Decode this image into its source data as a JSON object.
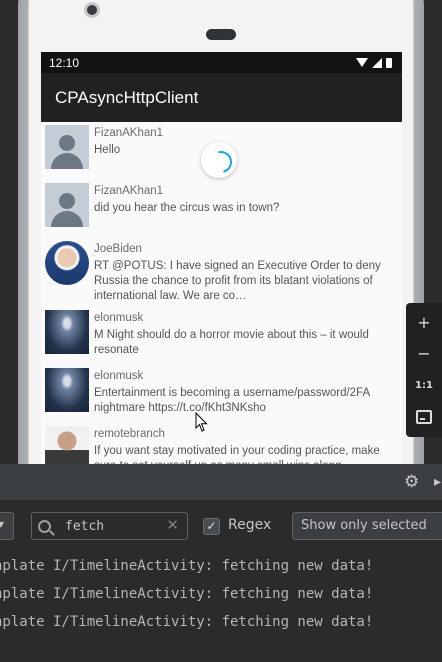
{
  "status_bar": {
    "time": "12:10",
    "icons": [
      "wifi-icon",
      "signal-icon",
      "battery-icon"
    ]
  },
  "app": {
    "title": "CPAsyncHttpClient"
  },
  "timeline": {
    "tweets": [
      {
        "handle": "FizanAKhan1",
        "text": "Hello",
        "avatar": "default-avatar"
      },
      {
        "handle": "FizanAKhan1",
        "text": "did you hear the circus was in town?",
        "avatar": "default-avatar"
      },
      {
        "handle": "JoeBiden",
        "text": "RT @POTUS: I have signed an Executive Order to deny Russia the chance to profit from its blatant violations of international law. We are co…",
        "avatar": "photo"
      },
      {
        "handle": "elonmusk",
        "text": "M Night should do a horror movie about this – it would resonate",
        "avatar": "photo"
      },
      {
        "handle": "elonmusk",
        "text": "Entertainment is becoming a username/password/2FA nightmare https://t.co/fKht3NKsho",
        "avatar": "photo"
      },
      {
        "handle": "remotebranch",
        "text": "If you want stay motivated in your coding practice, make sure to set yourself up as many small wins along",
        "avatar": "photo"
      }
    ]
  },
  "emulator_toolbar": {
    "zoom_in": "+",
    "zoom_out": "−",
    "one_to_one": "1:1"
  },
  "logcat": {
    "search": {
      "value": "fetch"
    },
    "regex_label": "Regex",
    "regex_checked": true,
    "filter_select": "Show only selected",
    "lines": [
      "nplate I/TimelineActivity: fetching new data!",
      "nplate I/TimelineActivity: fetching new data!",
      "nplate I/TimelineActivity: fetching new data!"
    ]
  },
  "colors": {
    "app_bar": "#212121",
    "spinner": "#15a4ea",
    "logcat_bg": "#2b2b2b"
  }
}
